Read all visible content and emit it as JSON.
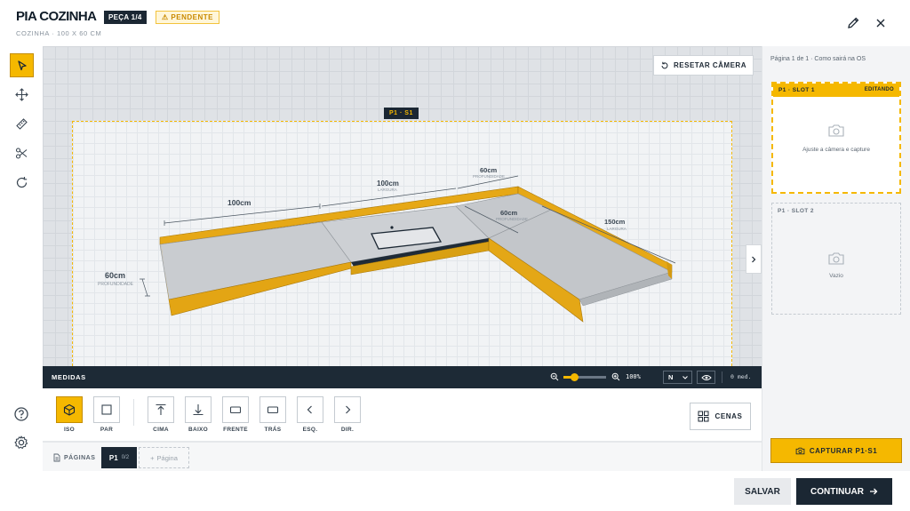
{
  "header": {
    "title": "PIA COZINHA",
    "piece_badge": "PEÇA 1/4",
    "status_badge": "PENDENTE",
    "subtitle": "COZINHA · 100 X 60 CM"
  },
  "viewport": {
    "reset_camera_label": "RESETAR CÂMERA",
    "area_tag": "P1 · S1",
    "dimensions": {
      "width_left": "100cm",
      "depth": "60cm",
      "depth_sub": "PROFUNDIDADE",
      "width_mid": "100cm",
      "width_mid_sub": "LARGURA",
      "width_right": "60cm",
      "width_right_sub": "PROFUNDIDADE",
      "inner_depth": "60cm",
      "inner_depth_sub": "PROFUNDIDADE",
      "return_length": "150cm",
      "return_length_sub": "LARGURA"
    }
  },
  "measure_bar": {
    "label": "MEDIDAS",
    "zoom": "100%",
    "zoom_level": 0.25,
    "unit": "N",
    "count": "0 med."
  },
  "views": [
    {
      "label": "ISO",
      "icon": "cube-icon",
      "active": true
    },
    {
      "label": "PAR",
      "icon": "square-icon",
      "active": false
    },
    {
      "label": "CIMA",
      "icon": "arrow-up-bar-icon",
      "active": false
    },
    {
      "label": "BAIXO",
      "icon": "arrow-down-bar-icon",
      "active": false
    },
    {
      "label": "FRENTE",
      "icon": "rectangle-icon",
      "active": false
    },
    {
      "label": "TRÁS",
      "icon": "rectangle-icon",
      "active": false
    },
    {
      "label": "ESQ.",
      "icon": "chevron-left-icon",
      "active": false
    },
    {
      "label": "DIR.",
      "icon": "chevron-right-icon",
      "active": false
    }
  ],
  "scenes_label": "CENAS",
  "pages": {
    "label": "PÁGINAS",
    "current_name": "P1",
    "current_count": "0/2",
    "add_label": "Página"
  },
  "panel": {
    "info": "Página 1 de 1 · Como sairá na OS",
    "slot1": {
      "name": "P1 · SLOT 1",
      "status": "EDITANDO",
      "hint": "Ajuste a câmera e capture"
    },
    "slot2": {
      "name": "P1 · SLOT 2",
      "hint": "Vazio"
    },
    "capture_label": "CAPTURAR P1·S1"
  },
  "footer": {
    "save_label": "SALVAR",
    "continue_label": "CONTINUAR"
  },
  "colors": {
    "accent": "#f5b800",
    "dark": "#1b2733",
    "countertop": "#c9ccd0",
    "edge": "#e0a514"
  }
}
